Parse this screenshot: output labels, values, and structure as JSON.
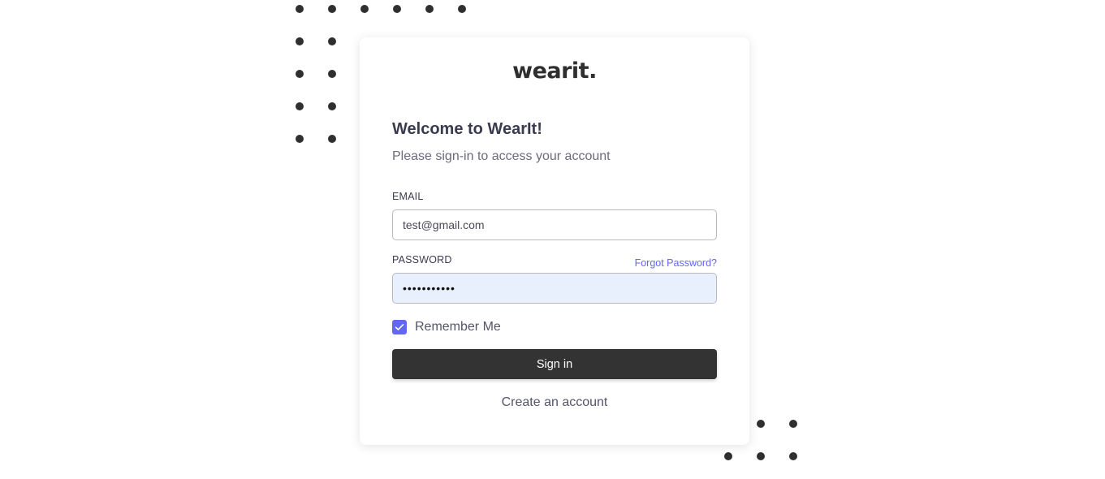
{
  "brand": {
    "logo_text": "wearit."
  },
  "login": {
    "heading": "Welcome to WearIt!",
    "subheading": "Please sign-in to access your account",
    "email_label": "EMAIL",
    "email_value": "test@gmail.com",
    "password_label": "PASSWORD",
    "password_value": "•••••••••••",
    "forgot_link": "Forgot Password?",
    "remember_label": "Remember Me",
    "remember_checked": true,
    "signin_label": "Sign in",
    "create_account_label": "Create an account"
  },
  "colors": {
    "accent": "#6366f1",
    "button_bg": "#333333",
    "dots": "#2f2f2f",
    "autofill_bg": "#e8f0fe"
  }
}
